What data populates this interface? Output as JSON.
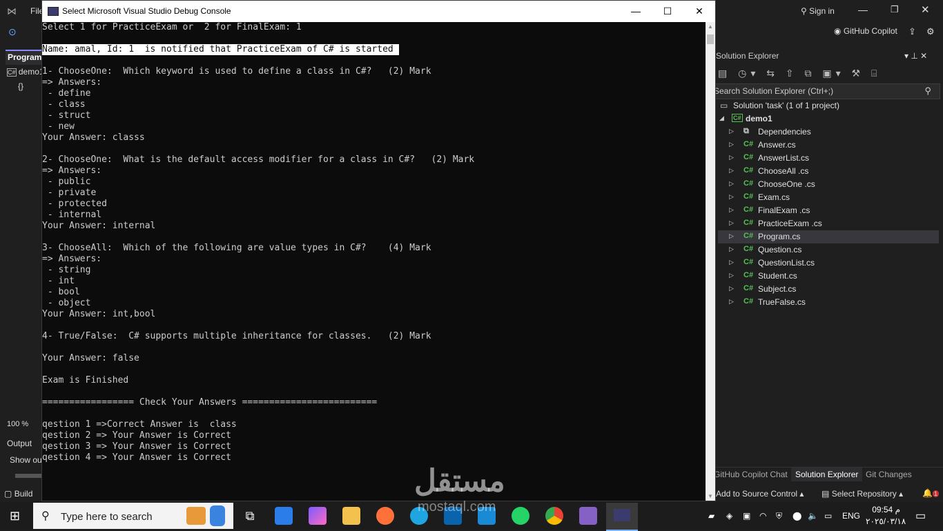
{
  "vs": {
    "menu_file": "File",
    "sign_in": "Sign in",
    "copilot": "GitHub Copilot",
    "left_tab": "Program",
    "left_item": "demo1",
    "zoom": "100 %",
    "output_tab": "Output",
    "show_output": "Show ou",
    "build": "Build"
  },
  "console": {
    "title": "Select Microsoft Visual Studio Debug Console",
    "lines": [
      "Select 1 for PracticeExam or  2 for FinalExam: 1",
      "",
      "Name: amal, Id: 1  is notified that PracticeExam of C# is started ",
      "",
      "1- ChooseOne:  Which keyword is used to define a class in C#?   (2) Mark",
      "=> Answers:",
      " - define",
      " - class",
      " - struct",
      " - new",
      "Your Answer: classs",
      "",
      "2- ChooseOne:  What is the default access modifier for a class in C#?   (2) Mark",
      "=> Answers:",
      " - public",
      " - private",
      " - protected",
      " - internal",
      "Your Answer: internal",
      "",
      "3- ChooseAll:  Which of the following are value types in C#?    (4) Mark",
      "=> Answers:",
      " - string",
      " - int",
      " - bool",
      " - object",
      "Your Answer: int,bool",
      "",
      "4- True/False:  C# supports multiple inheritance for classes.   (2) Mark",
      "",
      "Your Answer: false",
      "",
      "Exam is Finished",
      "",
      "================= Check Your Answers =========================",
      "",
      "qestion 1 =>Correct Answer is  class",
      "qestion 2 => Your Answer is Correct",
      "qestion 3 => Your Answer is Correct",
      "qestion 4 => Your Answer is Correct"
    ],
    "highlight_line": 2
  },
  "solution_explorer": {
    "title": "Solution Explorer",
    "search_placeholder": "Search Solution Explorer (Ctrl+;)",
    "solution": "Solution 'task' (1 of 1 project)",
    "project": "demo1",
    "items": [
      {
        "label": "Dependencies",
        "cs": false,
        "selected": false
      },
      {
        "label": "Answer.cs",
        "cs": true,
        "selected": false
      },
      {
        "label": "AnswerList.cs",
        "cs": true,
        "selected": false
      },
      {
        "label": "ChooseAll .cs",
        "cs": true,
        "selected": false
      },
      {
        "label": "ChooseOne .cs",
        "cs": true,
        "selected": false
      },
      {
        "label": "Exam.cs",
        "cs": true,
        "selected": false
      },
      {
        "label": "FinalExam .cs",
        "cs": true,
        "selected": false
      },
      {
        "label": "PracticeExam .cs",
        "cs": true,
        "selected": false
      },
      {
        "label": "Program.cs",
        "cs": true,
        "selected": true
      },
      {
        "label": "Question.cs",
        "cs": true,
        "selected": false
      },
      {
        "label": "QuestionList.cs",
        "cs": true,
        "selected": false
      },
      {
        "label": "Student.cs",
        "cs": true,
        "selected": false
      },
      {
        "label": "Subject.cs",
        "cs": true,
        "selected": false
      },
      {
        "label": "TrueFalse.cs",
        "cs": true,
        "selected": false
      }
    ],
    "bottom_tabs": [
      "GitHub Copilot Chat",
      "Solution Explorer",
      "Git Changes"
    ]
  },
  "statusbar": {
    "source_control": "Add to Source Control",
    "select_repo": "Select Repository",
    "notifications": "1"
  },
  "taskbar": {
    "search_placeholder": "Type here to search",
    "lang": "ENG",
    "time": "09:54 م",
    "date": "٢٠٢٥/٠٣/١٨"
  },
  "watermark": {
    "text": "مستقل",
    "sub": "mostaql.com"
  }
}
